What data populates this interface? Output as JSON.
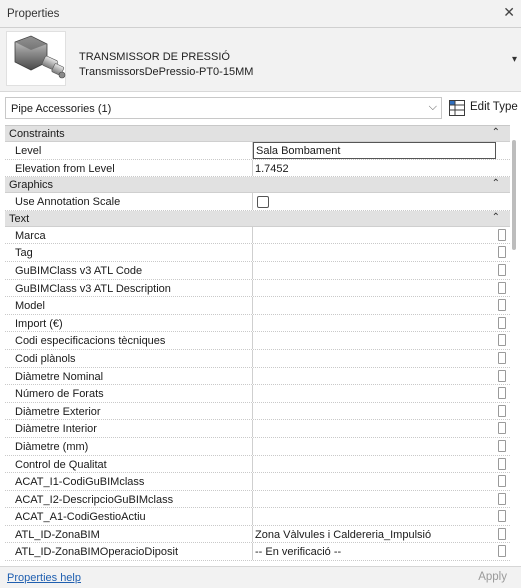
{
  "window": {
    "title": "Properties"
  },
  "type_selector": {
    "family": "TRANSMISSOR DE PRESSIÓ",
    "type": "TransmissorsDePressio-PT0-15MM"
  },
  "instance_filter": {
    "selected": "Pipe Accessories (1)"
  },
  "edit_type_label": "Edit Type",
  "groups": {
    "constraints": "Constraints",
    "graphics": "Graphics",
    "text": "Text"
  },
  "constraints": [
    {
      "name": "Level",
      "value": "Sala Bombament"
    },
    {
      "name": "Elevation from Level",
      "value": "1.7452"
    }
  ],
  "graphics": [
    {
      "name": "Use Annotation Scale",
      "checked": false
    }
  ],
  "text": [
    {
      "name": "Marca",
      "value": ""
    },
    {
      "name": "Tag",
      "value": ""
    },
    {
      "name": "GuBIMClass v3 ATL Code",
      "value": ""
    },
    {
      "name": "GuBIMClass v3 ATL Description",
      "value": ""
    },
    {
      "name": "Model",
      "value": ""
    },
    {
      "name": "Import (€)",
      "value": ""
    },
    {
      "name": "Codi especificacions tècniques",
      "value": ""
    },
    {
      "name": "Codi plànols",
      "value": ""
    },
    {
      "name": "Diàmetre Nominal",
      "value": ""
    },
    {
      "name": "Número de Forats",
      "value": ""
    },
    {
      "name": "Diàmetre Exterior",
      "value": ""
    },
    {
      "name": "Diàmetre Interior",
      "value": ""
    },
    {
      "name": "Diàmetre (mm)",
      "value": ""
    },
    {
      "name": "Control de Qualitat",
      "value": ""
    },
    {
      "name": "ACAT_I1-CodiGuBIMclass",
      "value": ""
    },
    {
      "name": "ACAT_I2-DescripcioGuBIMclass",
      "value": ""
    },
    {
      "name": "ACAT_A1-CodiGestioActiu",
      "value": ""
    },
    {
      "name": "ATL_ID-ZonaBIM",
      "value": "Zona Vàlvules i Caldereria_Impulsió"
    },
    {
      "name": "ATL_ID-ZonaBIMOperacioDiposit",
      "value": "-- En verificació --"
    }
  ],
  "footer": {
    "help_link": "Properties help",
    "apply_label": "Apply"
  },
  "icons": {
    "close": "close-icon",
    "collapse": "chevron-double-up-icon",
    "dropdown": "chevron-down-icon",
    "edit_type": "edit-type-icon"
  }
}
